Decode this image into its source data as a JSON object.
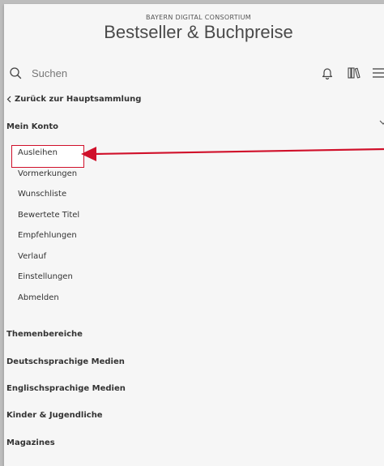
{
  "header": {
    "consortium": "BAYERN DIGITAL CONSORTIUM",
    "title": "Bestseller & Buchpreise"
  },
  "search": {
    "placeholder": "Suchen",
    "icon": "search-icon"
  },
  "toolbar": {
    "icons": [
      "bell-icon",
      "library-icon",
      "menu-icon"
    ]
  },
  "nav": {
    "back_label": "Zurück zur Hauptsammlung"
  },
  "account": {
    "title": "Mein Konto",
    "items": [
      "Ausleihen",
      "Vormerkungen",
      "Wunschliste",
      "Bewertete Titel",
      "Empfehlungen",
      "Verlauf",
      "Einstellungen",
      "Abmelden"
    ],
    "highlighted": "Ausleihen"
  },
  "sections": [
    "Themenbereiche",
    "Deutschsprachige Medien",
    "Englischsprachige Medien",
    "Kinder & Jugendliche",
    "Magazines"
  ],
  "colors": {
    "annotation": "#d0102a",
    "text": "#333333",
    "background": "#f6f6f6"
  }
}
